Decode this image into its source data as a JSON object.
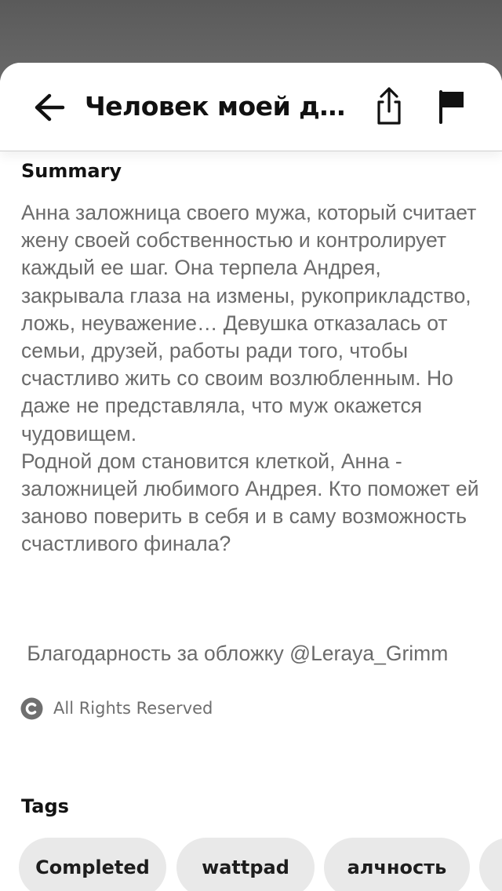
{
  "header": {
    "title": "Человек моей ду…"
  },
  "summary": {
    "heading": "Summary",
    "text": "Анна заложница своего мужа, который считает жену своей собственностью и контролирует каждый ее шаг. Она терпела Андрея, закрывала глаза на измены, рукоприкладство, ложь, неуважение… Девушка отказалась от семьи, друзей, работы ради того, чтобы счастливо жить со своим возлюбленным. Но даже не представляла, что муж окажется чудовищем.\n Родной дом становится клеткой, Анна - заложницей любимого Андрея. Кто поможет ей заново поверить в себя и в саму возможность счастливого финала?",
    "credit": " Благодарность за обложку @Leraya_Grimm"
  },
  "rights": {
    "icon": "copyright-icon",
    "label": "All Rights Reserved"
  },
  "tags": {
    "heading": "Tags",
    "items": [
      {
        "label": "Completed"
      },
      {
        "label": "wattpad"
      },
      {
        "label": "алчность"
      }
    ]
  },
  "icons": {
    "back": "arrow-left-icon",
    "share": "share-icon",
    "report": "flag-icon"
  },
  "colors": {
    "backdrop": "#5d5d5d",
    "sheet": "#ffffff",
    "text_primary": "#121212",
    "text_secondary": "#6b6b6b",
    "tag_bg": "#e9e9e9"
  }
}
